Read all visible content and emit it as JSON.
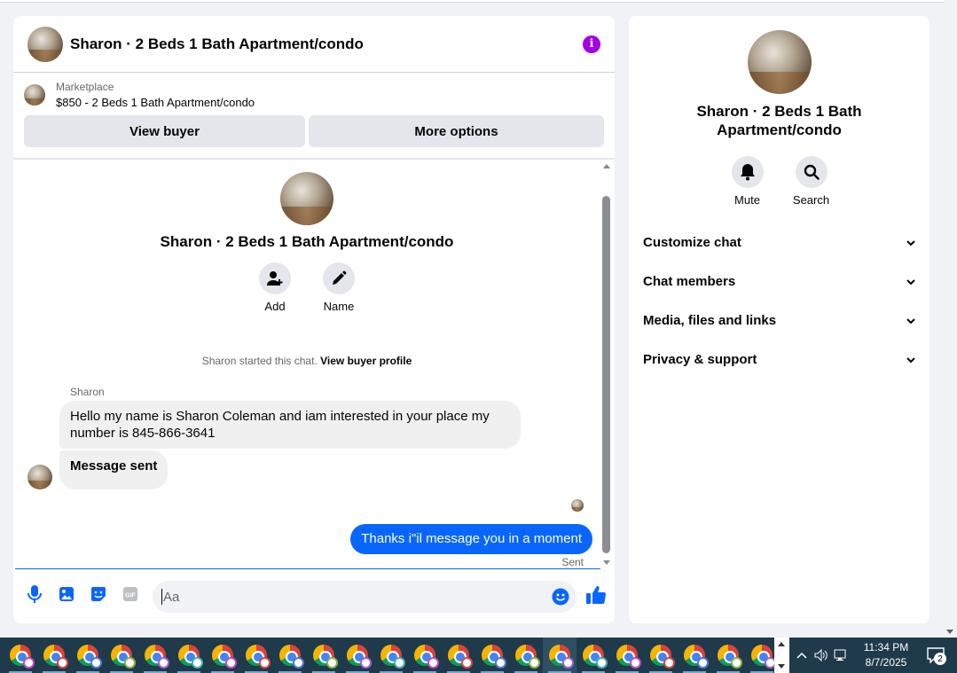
{
  "chat": {
    "title": "Sharon · 2 Beds 1 Bath Apartment/condo",
    "marketplace": {
      "label": "Marketplace",
      "listing": "$850 - 2 Beds 1 Bath Apartment/condo",
      "view_buyer": "View buyer",
      "more_options": "More options"
    },
    "intro": {
      "title": "Sharon · 2 Beds 1 Bath Apartment/condo",
      "add_label": "Add",
      "name_label": "Name"
    },
    "started_text": "Sharon started this chat.",
    "view_buyer_profile": "View buyer profile",
    "messages": [
      {
        "sender": "Sharon",
        "text": "Hello my name is Sharon Coleman and iam interested in your place my number is 845-866-3641"
      },
      {
        "text": "Message sent"
      },
      {
        "text": "Thanks i\"il message you in a moment",
        "status": "Sent"
      }
    ],
    "composer": {
      "placeholder": "Aa"
    }
  },
  "details": {
    "title": "Sharon · 2 Beds 1 Bath Apartment/condo",
    "mute_label": "Mute",
    "search_label": "Search",
    "sections": [
      "Customize chat",
      "Chat members",
      "Media, files and links",
      "Privacy & support"
    ]
  },
  "taskbar": {
    "app_count": 23,
    "time": "11:34 PM",
    "date": "8/7/2025",
    "notification_count": "2"
  },
  "colors": {
    "accent": "#0866ff",
    "info": "#a200e6",
    "taskbar": "#1f3a4a"
  }
}
